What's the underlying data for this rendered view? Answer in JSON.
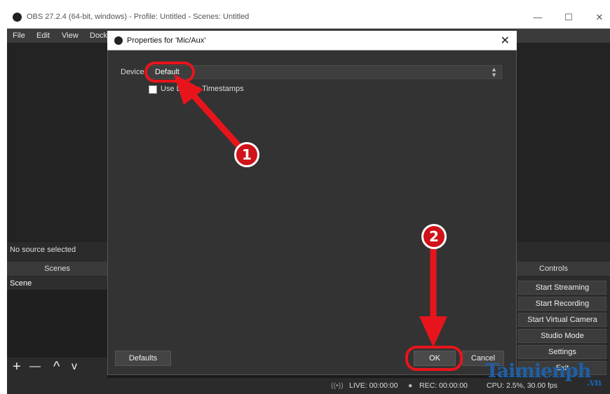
{
  "window": {
    "title": "OBS 27.2.4 (64-bit, windows) - Profile: Untitled - Scenes: Untitled",
    "controls": [
      "—",
      "☐",
      "✕"
    ]
  },
  "menu": [
    "File",
    "Edit",
    "View",
    "Dock"
  ],
  "sources": {
    "no_source": "No source selected"
  },
  "scenes": {
    "header": "Scenes",
    "items": [
      "Scene"
    ],
    "tools": [
      "+",
      "—",
      "^",
      "v"
    ]
  },
  "controls": {
    "header": "Controls",
    "buttons": [
      "Start Streaming",
      "Start Recording",
      "Start Virtual Camera",
      "Studio Mode",
      "Settings",
      "Exit"
    ]
  },
  "status": {
    "live": "LIVE: 00:00:00",
    "rec": "REC: 00:00:00",
    "cpu": "CPU: 2.5%, 30.00 fps"
  },
  "dialog": {
    "title": "Properties for 'Mic/Aux'",
    "device_label": "Device",
    "device_value": "Default",
    "timestamps_label": "Use Device Timestamps",
    "defaults_button": "Defaults",
    "ok_button": "OK",
    "cancel_button": "Cancel"
  },
  "annotations": {
    "step1": "1",
    "step2": "2",
    "arrow_color": "#e8141c"
  },
  "watermark": {
    "text": "Taimienph",
    "suffix": ".vn"
  }
}
